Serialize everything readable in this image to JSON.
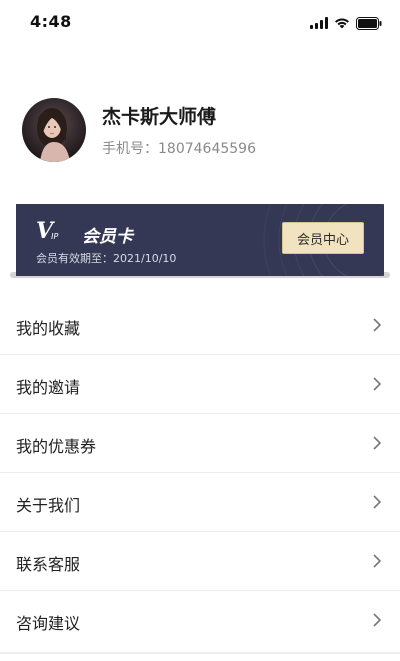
{
  "status_bar": {
    "time": "4:48",
    "icons": [
      "signal-icon",
      "wifi-icon",
      "battery-icon"
    ]
  },
  "profile": {
    "name": "杰卡斯大师傅",
    "phone_label": "手机号：",
    "phone": "18074645596"
  },
  "vip_card": {
    "logo_v": "V",
    "logo_ip": "IP",
    "title": "会员卡",
    "expiry": "会员有效期至：2021/10/10",
    "button_label": "会员中心",
    "colors": {
      "card_bg": "#353855",
      "button_bg": "#f1e3bf"
    }
  },
  "menu": {
    "items": [
      {
        "label": "我的收藏"
      },
      {
        "label": "我的邀请"
      },
      {
        "label": "我的优惠券"
      },
      {
        "label": "关于我们"
      },
      {
        "label": "联系客服"
      },
      {
        "label": "咨询建议"
      }
    ]
  }
}
